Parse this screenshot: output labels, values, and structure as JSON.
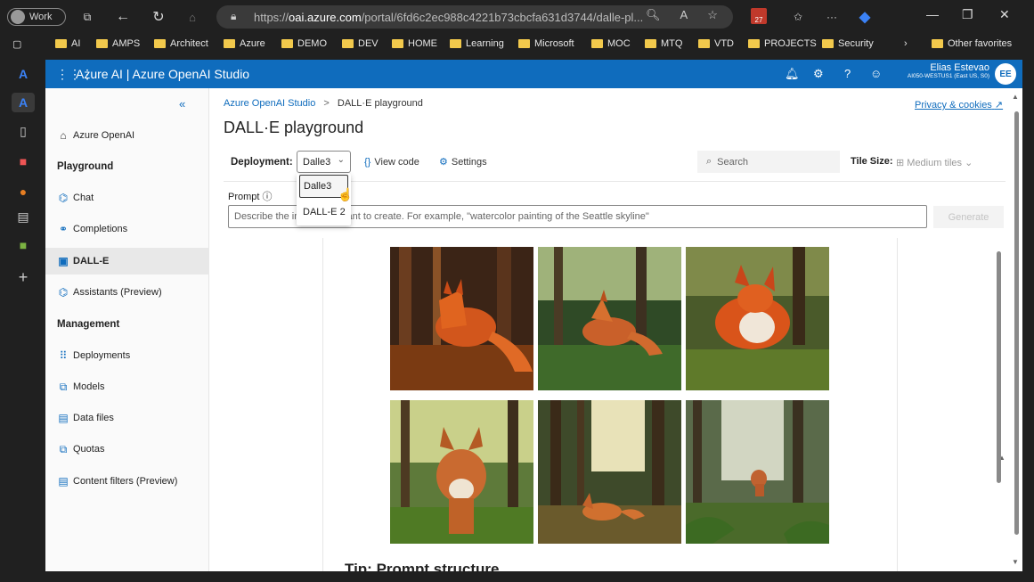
{
  "browser": {
    "profile_label": "Work",
    "url_prefix": "https://",
    "url_host": "oai.azure.com",
    "url_path": "/portal/6fd6c2ec988c4221b73cbcfa631d3744/dalle-pl...",
    "calendar_badge": "27"
  },
  "favorites": {
    "items": [
      "AI",
      "AMPS",
      "Architect",
      "Azure",
      "DEMO",
      "DEV",
      "HOME",
      "Learning",
      "Microsoft",
      "MOC",
      "MTQ",
      "VTD",
      "PROJECTS",
      "Security"
    ],
    "other": "Other favorites"
  },
  "appbar": {
    "title": "Azure AI  |  Azure OpenAI Studio",
    "user_name": "Elias Estevao",
    "user_sub": "AI050-WESTUS1 (East US, S0)",
    "avatar": "EE"
  },
  "nav": {
    "collapse": "«",
    "home": "Azure OpenAI",
    "playground_header": "Playground",
    "chat": "Chat",
    "completions": "Completions",
    "dalle": "DALL-E",
    "assistants": "Assistants (Preview)",
    "management_header": "Management",
    "deployments": "Deployments",
    "models": "Models",
    "data_files": "Data files",
    "quotas": "Quotas",
    "content_filters": "Content filters (Preview)"
  },
  "main": {
    "breadcrumb_link": "Azure OpenAI Studio",
    "breadcrumb_sep": ">",
    "breadcrumb_current": "DALL·E playground",
    "privacy": "Privacy & cookies",
    "title": "DALL·E playground",
    "deployment_label": "Deployment:",
    "deployment_value": "Dalle3",
    "deployment_options": [
      "Dalle3",
      "DALL-E 2"
    ],
    "view_code": "View code",
    "settings": "Settings",
    "search_placeholder": "Search",
    "tile_size_label": "Tile Size:",
    "tile_size_value": "Medium tiles",
    "prompt_label": "Prompt",
    "prompt_placeholder": "Describe the image you want to create. For example, \"watercolor painting of the Seattle skyline\"",
    "generate": "Generate",
    "tip_heading": "Tip: Prompt structure"
  },
  "images": [
    {
      "subject": "red fox in forest",
      "palette": "warm-dark"
    },
    {
      "subject": "red fox in forest",
      "palette": "green-light"
    },
    {
      "subject": "red fox in forest",
      "palette": "green-orange"
    },
    {
      "subject": "red fox in forest",
      "palette": "sunlit-green"
    },
    {
      "subject": "red fox in forest",
      "palette": "forest-light"
    },
    {
      "subject": "red fox in forest",
      "palette": "misty-green"
    }
  ]
}
